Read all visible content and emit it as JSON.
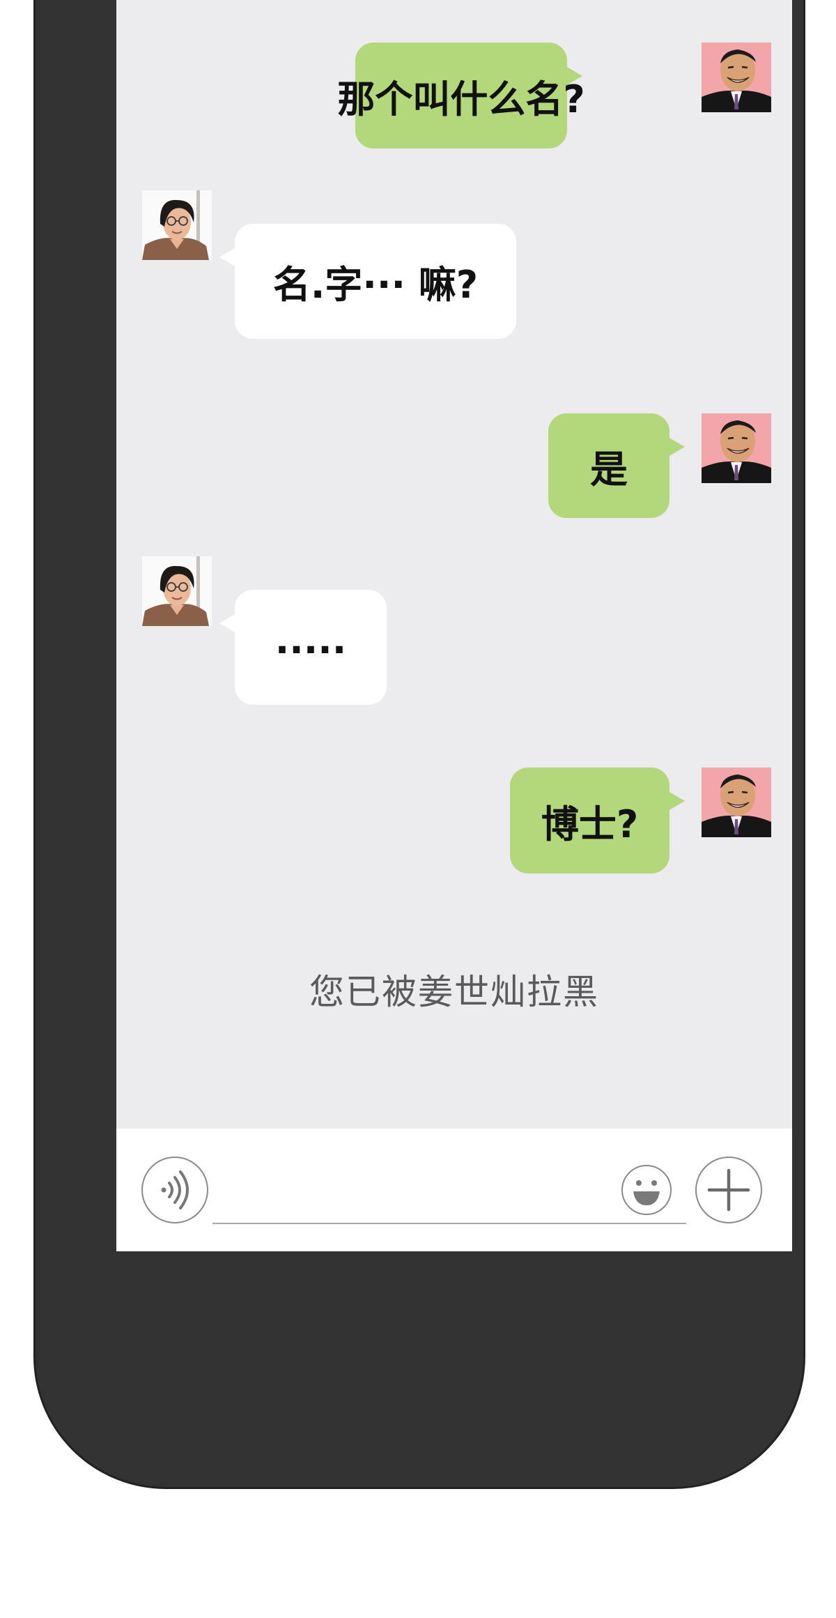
{
  "messages": [
    {
      "side": "sent",
      "text": "那个叫什么名?"
    },
    {
      "side": "received",
      "text": "名.字··· 嘛?"
    },
    {
      "side": "sent",
      "text": "是"
    },
    {
      "side": "received",
      "text": "....."
    },
    {
      "side": "sent",
      "text": "博士?"
    }
  ],
  "system_notice": "您已被姜世灿拉黑",
  "input_bar": {
    "voice_icon": "voice-icon",
    "emoji_icon": "emoji-icon",
    "plus_icon": "plus-icon"
  },
  "colors": {
    "sent_bubble": "#b3d87c",
    "received_bubble": "#ffffff",
    "chat_background": "#ececee",
    "phone_frame": "#333333"
  }
}
